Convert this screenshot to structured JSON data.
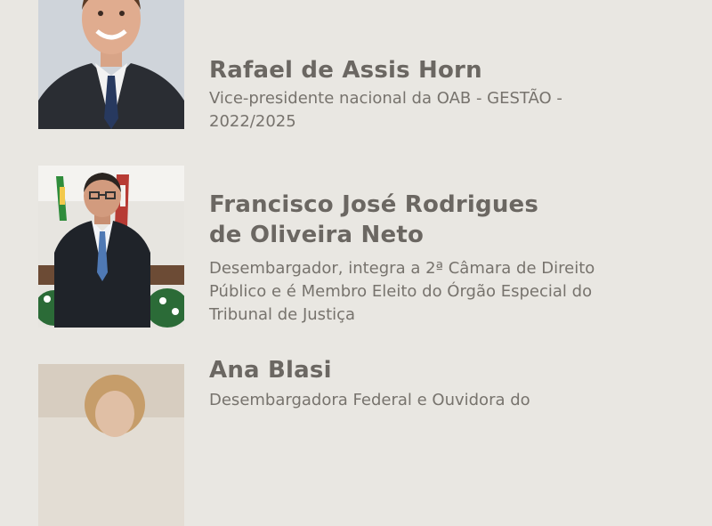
{
  "speakers": [
    {
      "name": "Rafael de Assis Horn",
      "role": "Vice-presidente nacional da OAB - GESTÃO - 2022/2025"
    },
    {
      "name": "Francisco José Rodrigues de Oliveira Neto",
      "role": "Desembargador, integra a 2ª Câmara de Direito Público e é Membro Eleito do Órgão Especial do Tribunal de Justiça"
    },
    {
      "name": "Ana Blasi",
      "role": "Desembargadora Federal e Ouvidora do"
    }
  ],
  "colors": {
    "background": "#e9e7e2",
    "name_text": "#6b6762",
    "role_text": "#77736d"
  }
}
